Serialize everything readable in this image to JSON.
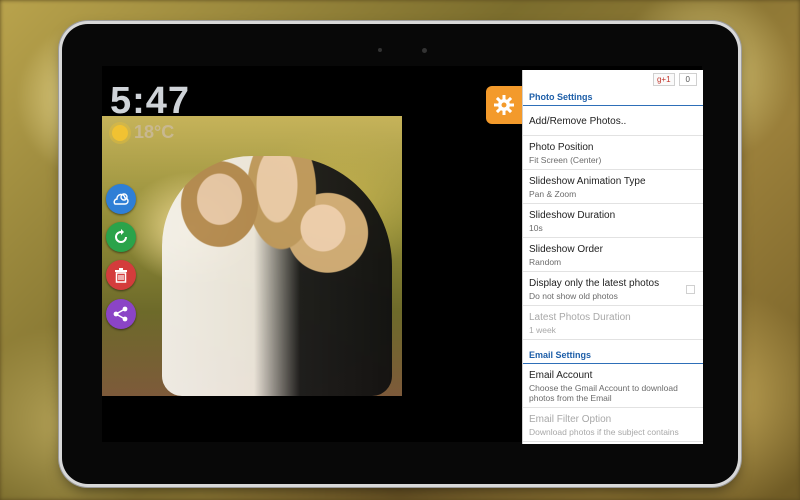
{
  "clock": {
    "time": "5:47"
  },
  "weather": {
    "temperature": "18°C"
  },
  "side_buttons": [
    {
      "icon": "weather-icon",
      "color": "#2f7fd6"
    },
    {
      "icon": "refresh-icon",
      "color": "#2aa34a"
    },
    {
      "icon": "trash-icon",
      "color": "#d43c3c"
    },
    {
      "icon": "share-icon",
      "color": "#8b44c6"
    }
  ],
  "settings_tab": {
    "icon": "gear-icon",
    "color": "#f39a2b"
  },
  "gplus": {
    "label": "g+1",
    "count": "0"
  },
  "photo_settings": {
    "header": "Photo Settings",
    "items": [
      {
        "title": "Add/Remove Photos..",
        "subtitle": ""
      },
      {
        "title": "Photo Position",
        "subtitle": "Fit Screen (Center)"
      },
      {
        "title": "Slideshow Animation Type",
        "subtitle": "Pan & Zoom"
      },
      {
        "title": "Slideshow Duration",
        "subtitle": "10s"
      },
      {
        "title": "Slideshow Order",
        "subtitle": "Random"
      },
      {
        "title": "Display only the latest photos",
        "subtitle": "Do not show old photos",
        "checked": false
      },
      {
        "title": "Latest Photos Duration",
        "subtitle": "1 week",
        "disabled": true
      }
    ]
  },
  "email_settings": {
    "header": "Email Settings",
    "items": [
      {
        "title": "Email Account",
        "subtitle": "Choose the Gmail Account to download photos from the Email"
      },
      {
        "title": "Email Filter Option",
        "subtitle": "Download photos if the subject contains",
        "disabled": true
      }
    ]
  }
}
